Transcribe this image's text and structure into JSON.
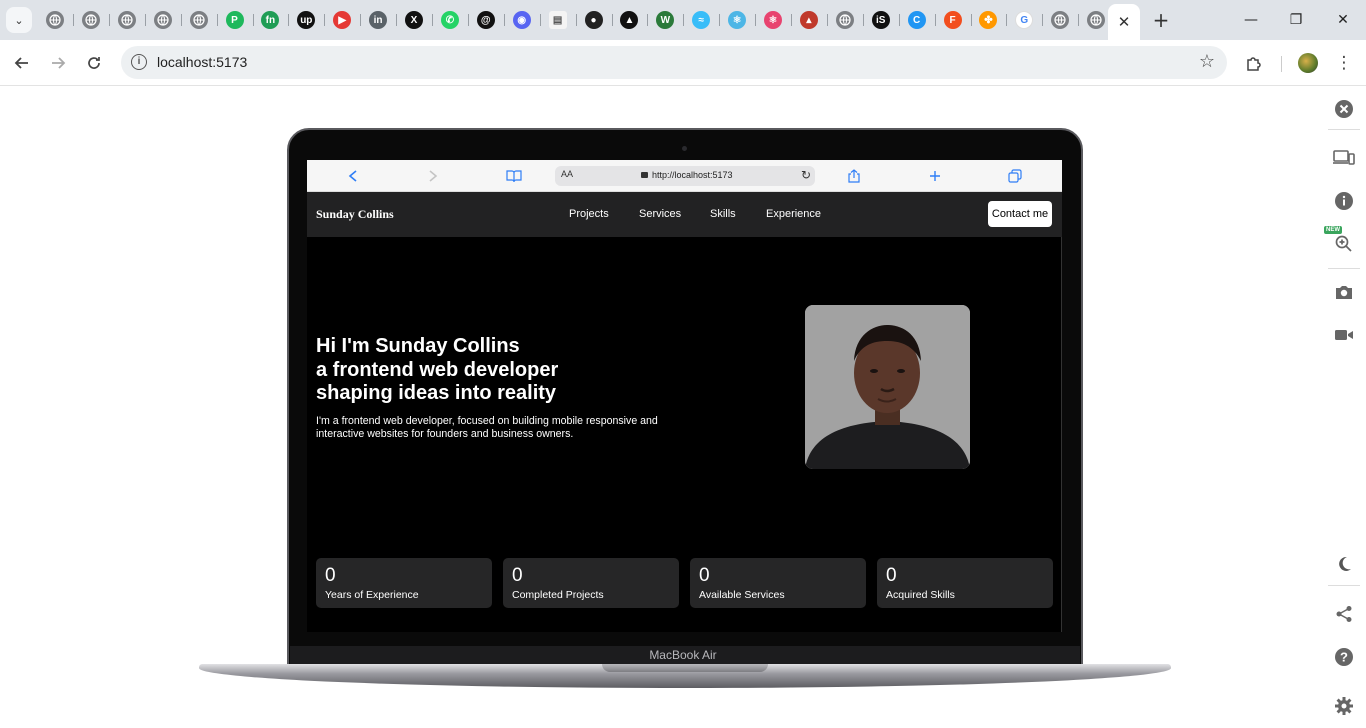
{
  "browser": {
    "tabs": [
      {
        "name": "tab-globe-1",
        "glyph": ""
      },
      {
        "name": "tab-globe-2",
        "glyph": ""
      },
      {
        "name": "tab-globe-3",
        "glyph": ""
      },
      {
        "name": "tab-globe-4",
        "glyph": ""
      },
      {
        "name": "tab-globe-5",
        "glyph": ""
      },
      {
        "name": "tab-pharmacy",
        "glyph": "P"
      },
      {
        "name": "tab-fn",
        "glyph": "fn"
      },
      {
        "name": "tab-upwork",
        "glyph": "up"
      },
      {
        "name": "tab-youtube",
        "glyph": "▶"
      },
      {
        "name": "tab-linkedin",
        "glyph": "in"
      },
      {
        "name": "tab-x",
        "glyph": "X"
      },
      {
        "name": "tab-whatsapp",
        "glyph": "✆"
      },
      {
        "name": "tab-threads",
        "glyph": "@"
      },
      {
        "name": "tab-discord",
        "glyph": "◉"
      },
      {
        "name": "tab-doc",
        "glyph": "▤"
      },
      {
        "name": "tab-github",
        "glyph": "●"
      },
      {
        "name": "tab-vercel",
        "glyph": "▲"
      },
      {
        "name": "tab-w",
        "glyph": "W"
      },
      {
        "name": "tab-tailwind",
        "glyph": "≈"
      },
      {
        "name": "tab-react-1",
        "glyph": "⚛"
      },
      {
        "name": "tab-react-2",
        "glyph": "⚛"
      },
      {
        "name": "tab-analytics",
        "glyph": "▴"
      },
      {
        "name": "tab-globe-6",
        "glyph": ""
      },
      {
        "name": "tab-is",
        "glyph": "iS"
      },
      {
        "name": "tab-c",
        "glyph": "C"
      },
      {
        "name": "tab-figma",
        "glyph": "F"
      },
      {
        "name": "tab-blocks",
        "glyph": "✤"
      },
      {
        "name": "tab-google",
        "glyph": "G"
      },
      {
        "name": "tab-globe-7",
        "glyph": ""
      },
      {
        "name": "tab-chrome",
        "glyph": ""
      }
    ],
    "active_tab_close": "✕",
    "new_tab": "+",
    "window_controls": {
      "minimize": "—",
      "restore": "❐",
      "close": "✕"
    },
    "address": "localhost:5173",
    "icons": {
      "back": "back-arrow-icon",
      "forward": "forward-arrow-icon",
      "reload": "reload-icon",
      "site_info": "site-info-icon",
      "bookmark": "star-icon",
      "extensions": "puzzle-icon",
      "menu": "kebab-menu-icon"
    }
  },
  "device_frame": {
    "label": "MacBook Air",
    "safari_url": "http://localhost:5173",
    "safari_aa": "AA"
  },
  "site": {
    "brand": "Sunday Collins",
    "nav": [
      "Projects",
      "Services",
      "Skills",
      "Experience"
    ],
    "cta": "Contact me",
    "hero": {
      "line1": "Hi I'm Sunday Collins",
      "line2": "a frontend web developer",
      "line3": "shaping ideas into reality",
      "paragraph": "I'm a frontend web developer, focused on building mobile responsive and interactive websites for founders and business owners."
    },
    "stats": [
      {
        "value": "0",
        "label": "Years of Experience"
      },
      {
        "value": "0",
        "label": "Completed Projects"
      },
      {
        "value": "0",
        "label": "Available Services"
      },
      {
        "value": "0",
        "label": "Acquired Skills"
      }
    ]
  },
  "side_panel": {
    "new_badge": "NEW",
    "icons": [
      "close-circle-icon",
      "devices-icon",
      "info-icon",
      "zoom-in-icon",
      "camera-icon",
      "video-icon",
      "dark-mode-icon",
      "share-icon",
      "help-icon",
      "settings-icon"
    ]
  },
  "colors": {
    "chrome_tabstrip": "#dfe3e8",
    "site_bg": "#000000",
    "nav_bg": "#222223",
    "card_bg": "#262627",
    "safari_accent": "#2f7ef6"
  }
}
